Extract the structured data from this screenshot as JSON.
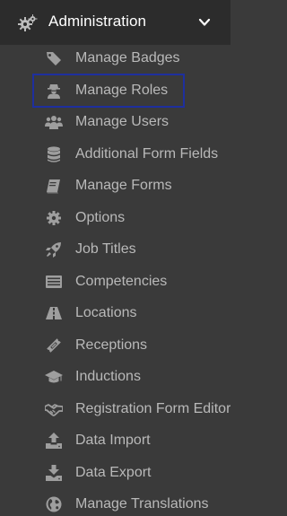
{
  "header": {
    "title": "Administration",
    "icon": "gears-icon",
    "chevron": "chevron-down-icon"
  },
  "menu": {
    "items": [
      {
        "label": "Manage Badges",
        "icon": "tag-icon"
      },
      {
        "label": "Manage Roles",
        "icon": "user-secret-icon",
        "highlighted": true
      },
      {
        "label": "Manage Users",
        "icon": "users-icon"
      },
      {
        "label": "Additional Form Fields",
        "icon": "database-icon"
      },
      {
        "label": "Manage Forms",
        "icon": "book-icon"
      },
      {
        "label": "Options",
        "icon": "gear-icon"
      },
      {
        "label": "Job Titles",
        "icon": "rocket-icon"
      },
      {
        "label": "Competencies",
        "icon": "list-alt-icon"
      },
      {
        "label": "Locations",
        "icon": "road-icon"
      },
      {
        "label": "Receptions",
        "icon": "ticket-icon"
      },
      {
        "label": "Inductions",
        "icon": "graduation-cap-icon"
      },
      {
        "label": "Registration Form Editor",
        "icon": "handshake-icon"
      },
      {
        "label": "Data Import",
        "icon": "upload-icon"
      },
      {
        "label": "Data Export",
        "icon": "download-icon"
      },
      {
        "label": "Manage Translations",
        "icon": "globe-icon"
      }
    ]
  },
  "colors": {
    "background": "#3a3a3a",
    "header_background": "#2c2c2c",
    "text": "#b9b9b9",
    "header_text": "#ffffff",
    "highlight_border": "#1e2f9e"
  }
}
